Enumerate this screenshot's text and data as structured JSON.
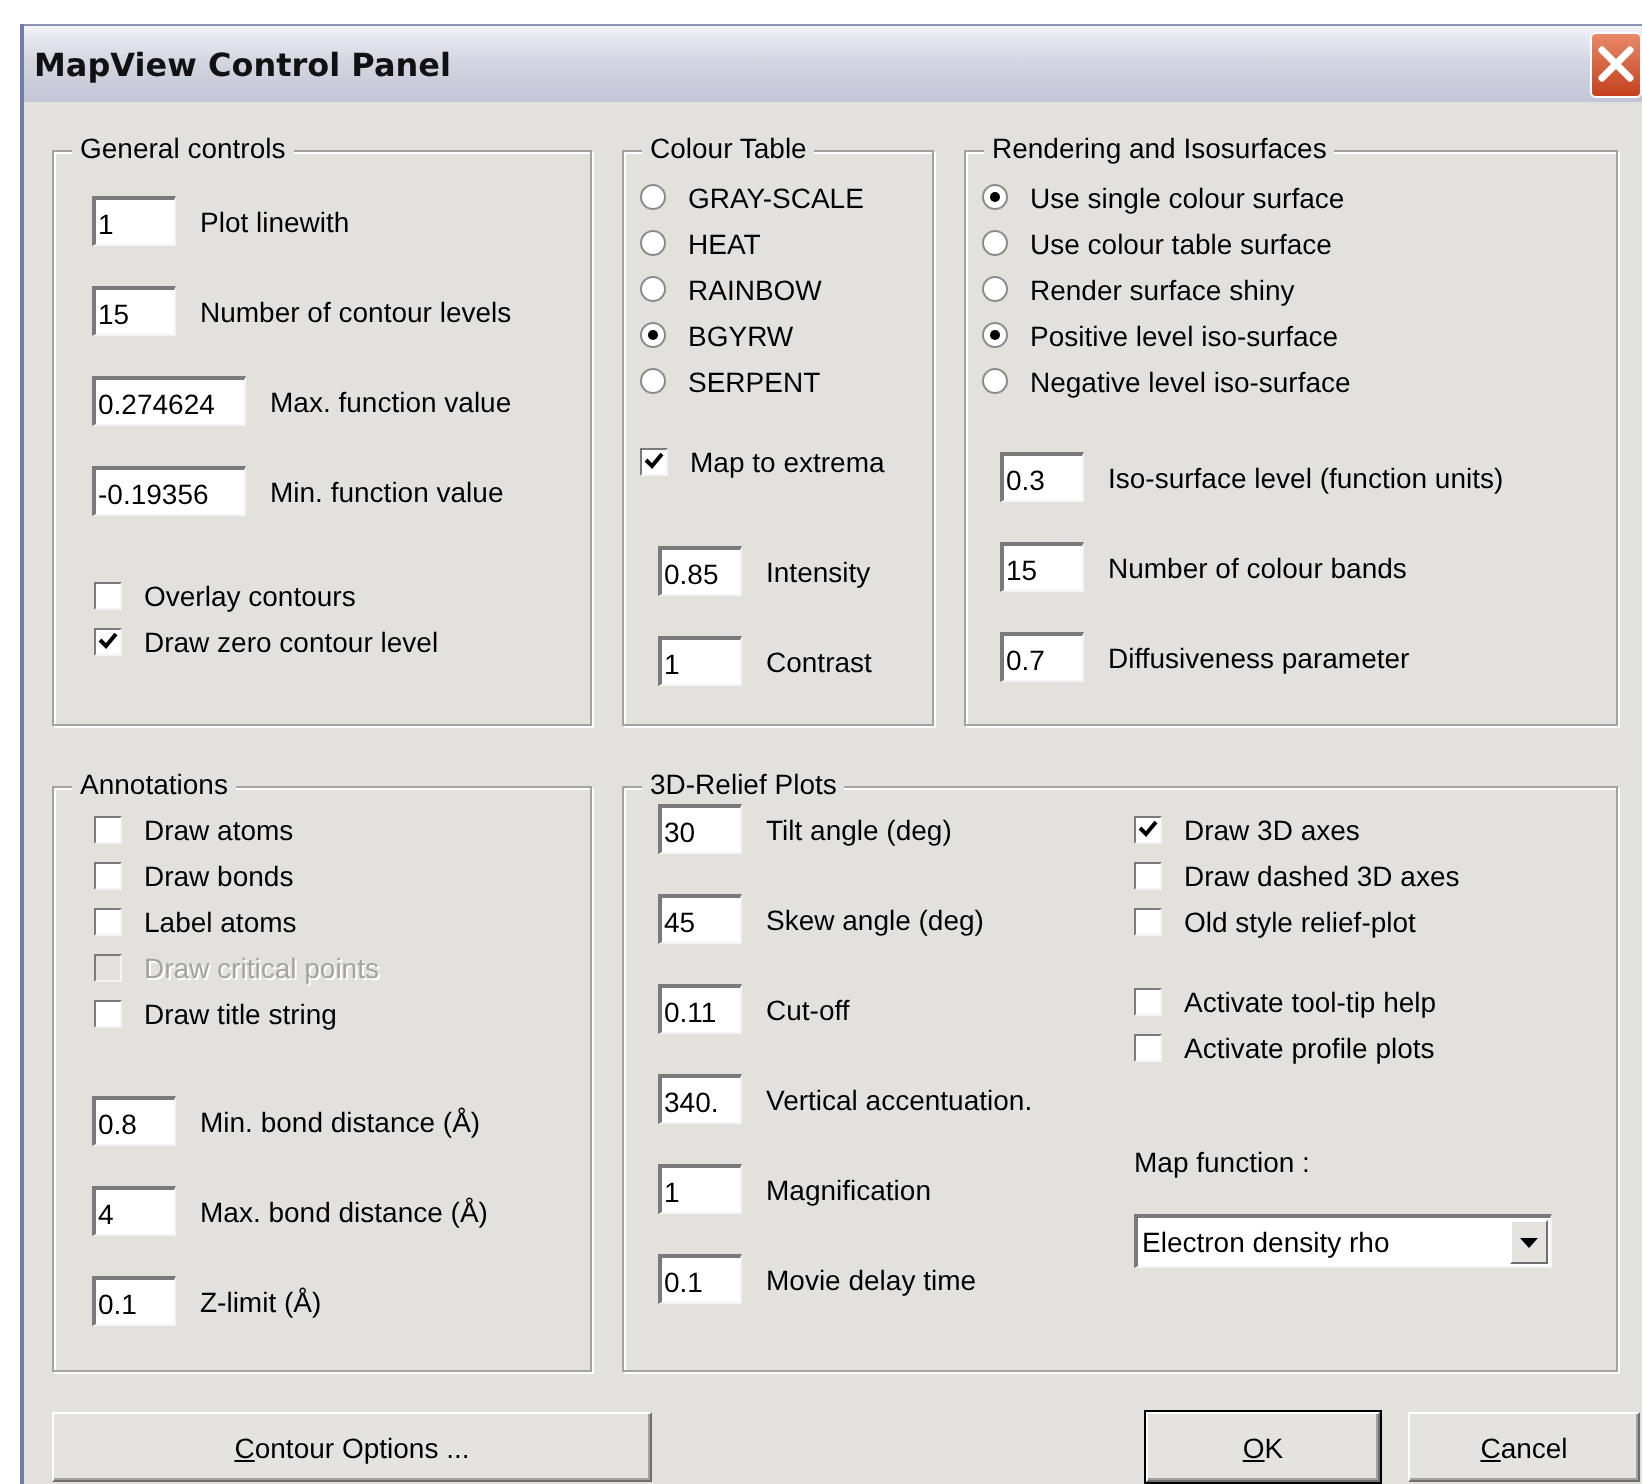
{
  "window": {
    "title": "MapView Control Panel"
  },
  "general_controls": {
    "title": "General controls",
    "fields": [
      {
        "value": "1",
        "label": "Plot linewith"
      },
      {
        "value": "15",
        "label": "Number of contour levels"
      },
      {
        "value": "0.274624",
        "label": "Max. function value"
      },
      {
        "value": "-0.19356",
        "label": "Min. function value"
      }
    ],
    "options": [
      {
        "label": "Overlay contours",
        "checked": false
      },
      {
        "label": "Draw zero contour level",
        "checked": true
      }
    ]
  },
  "colour_table": {
    "title": "Colour Table",
    "tables": [
      {
        "label": "GRAY-SCALE",
        "selected": false
      },
      {
        "label": "HEAT",
        "selected": false
      },
      {
        "label": "RAINBOW",
        "selected": false
      },
      {
        "label": "BGYRW",
        "selected": true
      },
      {
        "label": "SERPENT",
        "selected": false
      }
    ],
    "options": [
      {
        "label": "Map to extrema",
        "checked": true
      }
    ],
    "fields": [
      {
        "value": "0.85",
        "label": "Intensity"
      },
      {
        "value": "1",
        "label": "Contrast"
      }
    ]
  },
  "rendering": {
    "title": "Rendering and Isosurfaces",
    "modes": [
      {
        "label": "Use single colour surface",
        "selected": true
      },
      {
        "label": "Use colour table surface",
        "selected": false
      },
      {
        "label": "Render surface shiny",
        "selected": false
      },
      {
        "label": "Positive level iso-surface",
        "selected": true
      },
      {
        "label": "Negative level iso-surface",
        "selected": false
      }
    ],
    "fields": [
      {
        "value": "0.3",
        "label": "Iso-surface level (function units)"
      },
      {
        "value": "15",
        "label": "Number of colour bands"
      },
      {
        "value": "0.7",
        "label": "Diffusiveness parameter"
      }
    ]
  },
  "annotations": {
    "title": "Annotations",
    "options": [
      {
        "label": "Draw atoms",
        "checked": false,
        "disabled": false
      },
      {
        "label": "Draw bonds",
        "checked": false,
        "disabled": false
      },
      {
        "label": "Label atoms",
        "checked": false,
        "disabled": false
      },
      {
        "label": "Draw critical points",
        "checked": false,
        "disabled": true
      },
      {
        "label": "Draw title string",
        "checked": false,
        "disabled": false
      }
    ],
    "fields": [
      {
        "value": "0.8",
        "label": "Min. bond distance (Å)"
      },
      {
        "value": "4",
        "label": "Max. bond distance (Å)"
      },
      {
        "value": "0.1",
        "label": "Z-limit (Å)"
      }
    ]
  },
  "relief_plots": {
    "title": "3D-Relief Plots",
    "fields": [
      {
        "value": "30",
        "label": "Tilt angle (deg)"
      },
      {
        "value": "45",
        "label": "Skew angle (deg)"
      },
      {
        "value": "0.11",
        "label": "Cut-off"
      },
      {
        "value": "340.",
        "label": "Vertical accentuation."
      },
      {
        "value": "1",
        "label": "Magnification"
      },
      {
        "value": "0.1",
        "label": "Movie delay time"
      }
    ],
    "axes_options": [
      {
        "label": "Draw 3D axes",
        "checked": true
      },
      {
        "label": "Draw dashed 3D axes",
        "checked": false
      },
      {
        "label": "Old style relief-plot",
        "checked": false
      }
    ],
    "help_options": [
      {
        "label": "Activate tool-tip help",
        "checked": false
      },
      {
        "label": "Activate profile plots",
        "checked": false
      }
    ],
    "map_function": {
      "label": "Map function :",
      "value": "Electron density rho"
    }
  },
  "buttons": [
    {
      "access_key": "C",
      "rest": "ontour Options ...",
      "default": false
    },
    {
      "access_key": "O",
      "rest": "K",
      "default": true
    },
    {
      "access_key": "C",
      "rest": "ancel",
      "default": false
    }
  ]
}
